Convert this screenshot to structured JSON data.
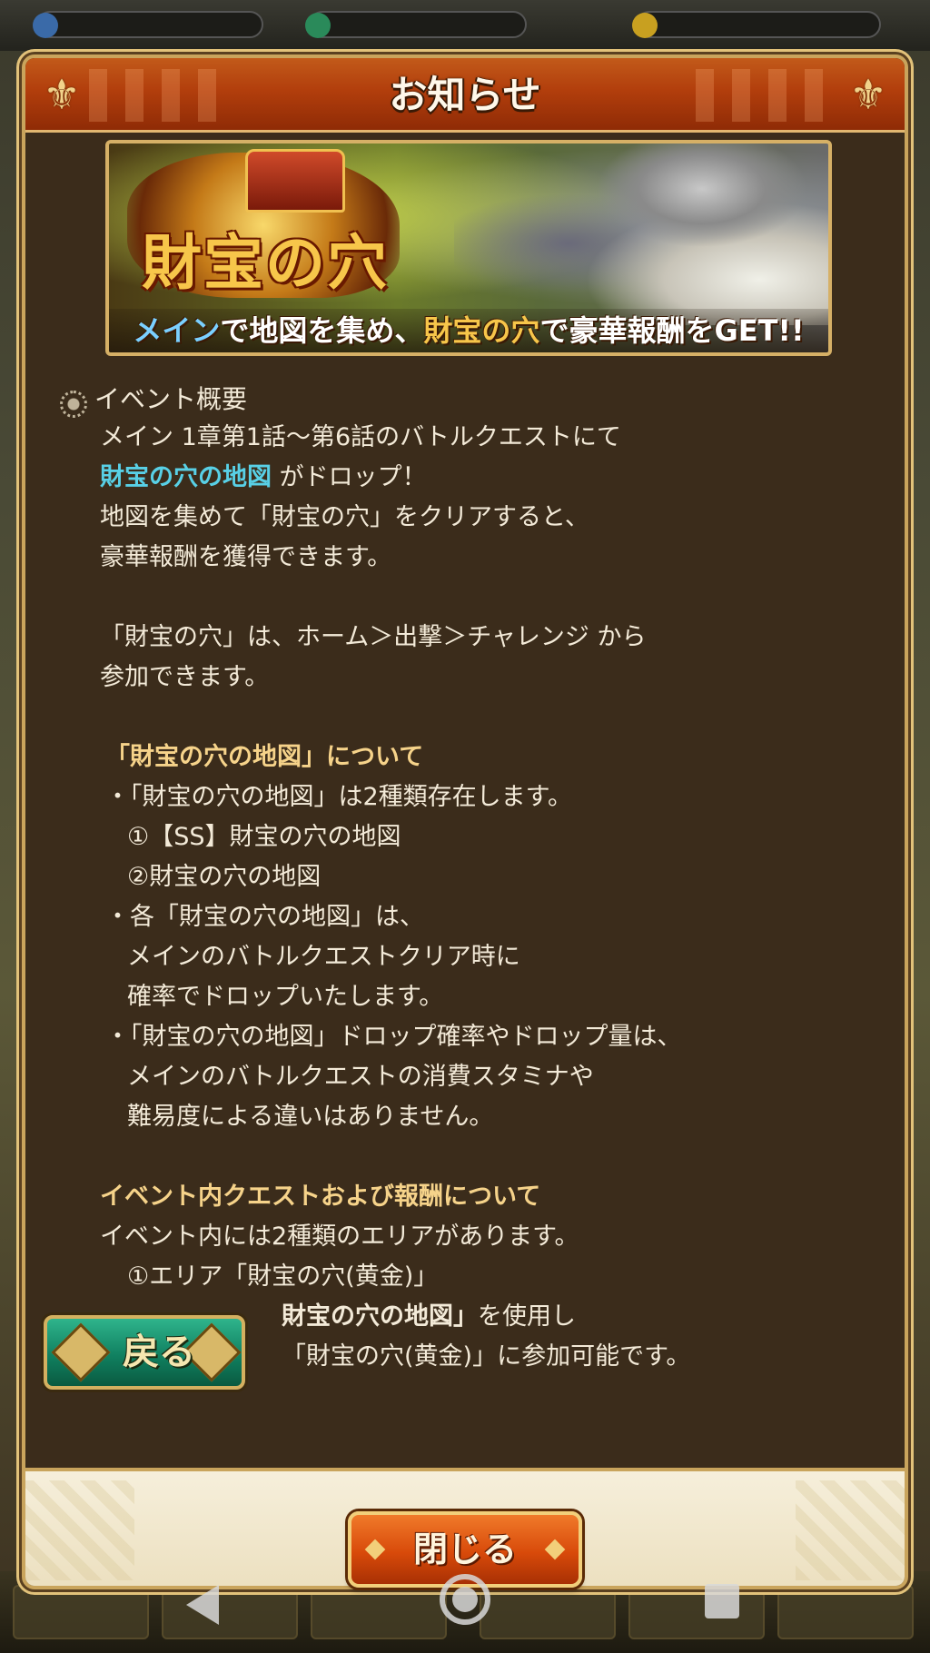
{
  "modal": {
    "title": "お知らせ"
  },
  "banner": {
    "logo": "財宝の穴",
    "caption_main": "メイン",
    "caption_1": "で地図を集め、",
    "caption_place": "財宝の穴",
    "caption_2": "で豪華報酬をGET!!"
  },
  "body": {
    "section1_heading": "イベント概要",
    "l1": "メイン 1章第1話～第6話のバトルクエストにて",
    "l2_highlight": "財宝の穴の地図",
    "l2_rest": " がドロップ！",
    "l3": "地図を集めて「財宝の穴」をクリアすると、",
    "l4": "豪華報酬を獲得できます。",
    "l5": "「財宝の穴」は、ホーム＞出撃＞チャレンジ から",
    "l6": "参加できます。",
    "section2_heading": "「財宝の穴の地図」について",
    "l7": "・「財宝の穴の地図」は2種類存在します。",
    "l8": "①【SS】財宝の穴の地図",
    "l9": "②財宝の穴の地図",
    "l10": "・各「財宝の穴の地図」は、",
    "l11": "メインのバトルクエストクリア時に",
    "l12": "確率でドロップいたします。",
    "l13": "・「財宝の穴の地図」ドロップ確率やドロップ量は、",
    "l14": "メインのバトルクエストの消費スタミナや",
    "l15": "難易度による違いはありません。",
    "section3_heading": "イベント内クエストおよび報酬について",
    "l16": "イベント内には2種類のエリアがあります。",
    "l17": "①エリア「財宝の穴(黄金)」",
    "l18_highlight": "財宝の穴の地図」",
    "l18_rest": "を使用し",
    "l19": "「財宝の穴(黄金)」に参加可能です。"
  },
  "buttons": {
    "back_label": "戻る",
    "close_label": "閉じる"
  },
  "icons": {
    "bullet_icon": "sun-bullet-icon",
    "back_ornament": "diamond-ornament-icon"
  },
  "colors": {
    "header": "#b23e0c",
    "body_bg": "#3b2c1b",
    "highlight": "#58d0e6",
    "heading_gold": "#f6d38a",
    "back_button": "#108060",
    "close_button": "#d84a0a"
  }
}
